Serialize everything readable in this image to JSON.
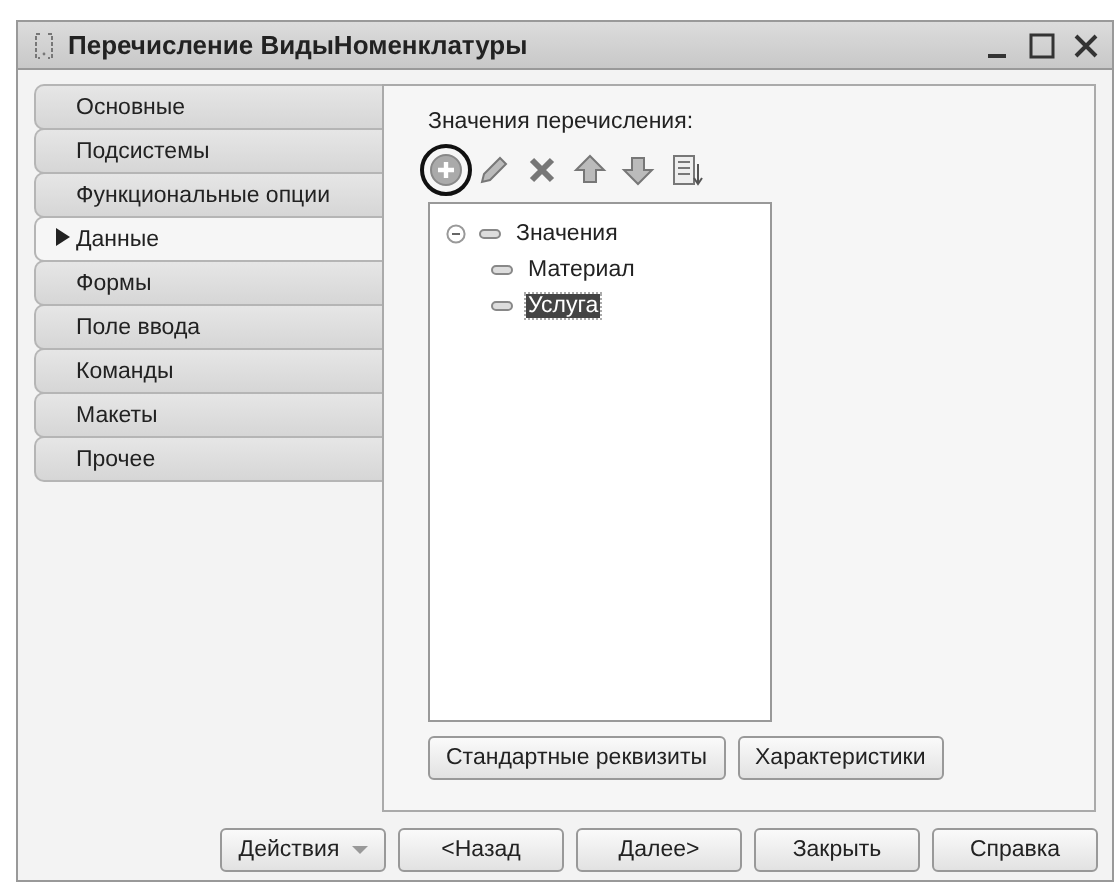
{
  "window": {
    "title": "Перечисление ВидыНоменклатуры"
  },
  "tabs": [
    {
      "label": "Основные",
      "selected": false
    },
    {
      "label": "Подсистемы",
      "selected": false
    },
    {
      "label": "Функциональные опции",
      "selected": false
    },
    {
      "label": "Данные",
      "selected": true
    },
    {
      "label": "Формы",
      "selected": false
    },
    {
      "label": "Поле ввода",
      "selected": false
    },
    {
      "label": "Команды",
      "selected": false
    },
    {
      "label": "Макеты",
      "selected": false
    },
    {
      "label": "Прочее",
      "selected": false
    }
  ],
  "values_panel": {
    "label": "Значения перечисления:",
    "toolbar": [
      {
        "kind": "add",
        "highlighted": true
      },
      {
        "kind": "edit",
        "highlighted": false
      },
      {
        "kind": "delete",
        "highlighted": false
      },
      {
        "kind": "up",
        "highlighted": false
      },
      {
        "kind": "down",
        "highlighted": false
      },
      {
        "kind": "sort",
        "highlighted": false
      }
    ],
    "tree": [
      {
        "label": "Значения",
        "expanded": true,
        "selected": false,
        "children": [
          {
            "label": "Материал",
            "selected": false
          },
          {
            "label": "Услуга",
            "selected": true
          }
        ]
      }
    ],
    "buttons": [
      "Стандартные реквизиты",
      "Характеристики"
    ]
  },
  "footer_buttons": [
    {
      "label": "Действия",
      "kind": "dropdown"
    },
    {
      "label": "<Назад",
      "kind": "plain"
    },
    {
      "label": "Далее>",
      "kind": "plain"
    },
    {
      "label": "Закрыть",
      "kind": "plain"
    },
    {
      "label": "Справка",
      "kind": "plain"
    }
  ]
}
